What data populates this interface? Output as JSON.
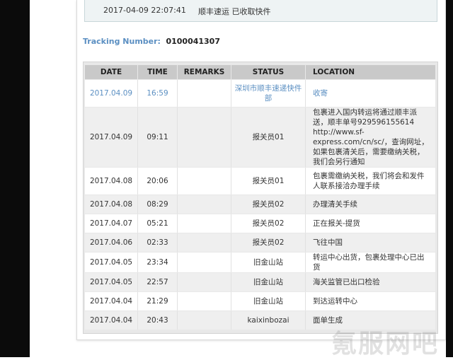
{
  "top_entry": {
    "date": "2017-04-09 22:07:41",
    "desc": "顺丰速运 已收取快件"
  },
  "tracking": {
    "label": "Tracking Number:",
    "number": "0100041307"
  },
  "table": {
    "headers": {
      "date": "DATE",
      "time": "TIME",
      "remarks": "REMARKS",
      "status": "STATUS",
      "location": "LOCATION"
    },
    "rows": [
      {
        "date": "2017.04.09",
        "time": "16:59",
        "remarks": "",
        "status": "深圳市顺丰速递快件部",
        "location": "收寄"
      },
      {
        "date": "2017.04.09",
        "time": "09:11",
        "remarks": "",
        "status": "报关员01",
        "location": "包裹进入国内转运将通过顺丰派送，顺丰单号929596155614 http://www.sf-express.com/cn/sc/，查询网址，如果包裹清关后，需要缴纳关税，我们会另行通知"
      },
      {
        "date": "2017.04.08",
        "time": "20:06",
        "remarks": "",
        "status": "报关员01",
        "location": "包裹需缴纳关税，我们将会和发件人联系接洽办理手续"
      },
      {
        "date": "2017.04.08",
        "time": "08:29",
        "remarks": "",
        "status": "报关员02",
        "location": "办理清关手续"
      },
      {
        "date": "2017.04.07",
        "time": "05:21",
        "remarks": "",
        "status": "报关员02",
        "location": "正在报关-提货"
      },
      {
        "date": "2017.04.06",
        "time": "02:33",
        "remarks": "",
        "status": "报关员02",
        "location": "飞往中国"
      },
      {
        "date": "2017.04.05",
        "time": "23:34",
        "remarks": "",
        "status": "旧金山站",
        "location": "转运中心出货，包裹处理中心已出货"
      },
      {
        "date": "2017.04.05",
        "time": "22:57",
        "remarks": "",
        "status": "旧金山站",
        "location": "海关监管已出口检验"
      },
      {
        "date": "2017.04.04",
        "time": "21:29",
        "remarks": "",
        "status": "旧金山站",
        "location": "到达运转中心"
      },
      {
        "date": "2017.04.04",
        "time": "20:43",
        "remarks": "",
        "status": "kaixinbozai",
        "location": "面单生成"
      }
    ]
  },
  "watermark": "氪服网吧"
}
